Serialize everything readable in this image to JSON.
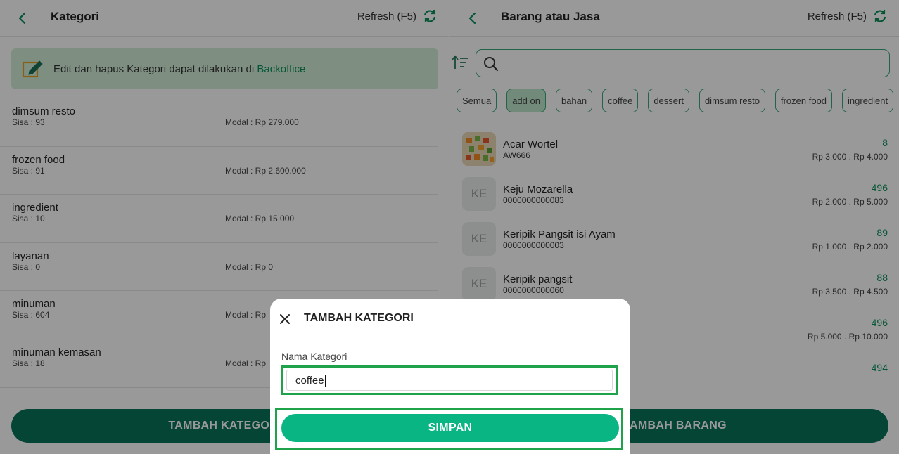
{
  "left_panel": {
    "title": "Kategori",
    "refresh_label": "Refresh (F5)",
    "notice": {
      "text": "Edit dan hapus Kategori dapat dilakukan di",
      "link": "Backoffice"
    },
    "categories": [
      {
        "name": "dimsum resto",
        "sisa": "Sisa : 93",
        "modal": "Modal : Rp 279.000"
      },
      {
        "name": "frozen food",
        "sisa": "Sisa : 91",
        "modal": "Modal : Rp 2.600.000"
      },
      {
        "name": "ingredient",
        "sisa": "Sisa : 10",
        "modal": "Modal : Rp 15.000"
      },
      {
        "name": "layanan",
        "sisa": "Sisa : 0",
        "modal": "Modal : Rp 0"
      },
      {
        "name": "minuman",
        "sisa": "Sisa : 604",
        "modal": "Modal : Rp"
      },
      {
        "name": "minuman kemasan",
        "sisa": "Sisa : 18",
        "modal": "Modal : Rp"
      }
    ],
    "add_button": "TAMBAH KATEGORI"
  },
  "right_panel": {
    "title": "Barang atau Jasa",
    "refresh_label": "Refresh (F5)",
    "search_placeholder": "",
    "chips": [
      "Semua",
      "add on",
      "bahan",
      "coffee",
      "dessert",
      "dimsum resto",
      "frozen food",
      "ingredient"
    ],
    "active_chip": "add on",
    "items": [
      {
        "name": "Acar Wortel",
        "code": "AW666",
        "stock": "8",
        "price": "Rp 3.000 .  Rp 4.000",
        "thumb": "image"
      },
      {
        "name": "Keju Mozarella",
        "code": "0000000000083",
        "stock": "496",
        "price": "Rp 2.000 .  Rp 5.000",
        "thumb": "KE"
      },
      {
        "name": "Keripik Pangsit isi Ayam",
        "code": "0000000000003",
        "stock": "89",
        "price": "Rp 1.000 .  Rp 2.000",
        "thumb": "KE"
      },
      {
        "name": "Keripik pangsit",
        "code": "0000000000060",
        "stock": "88",
        "price": "Rp 3.500 .  Rp 4.500",
        "thumb": "KE"
      },
      {
        "name": "",
        "code": "",
        "stock": "496",
        "price": "Rp 5.000 .  Rp 10.000",
        "thumb": ""
      },
      {
        "name": "",
        "code": "",
        "stock": "494",
        "price": "",
        "thumb": ""
      }
    ],
    "add_button": "TAMBAH BARANG"
  },
  "dialog": {
    "title": "TAMBAH KATEGORI",
    "field_label": "Nama Kategori",
    "field_value": "coffee",
    "save_button": "SIMPAN"
  },
  "colors": {
    "accent": "#08735a",
    "link": "#0a8f5a",
    "chip_border": "#3aa57a",
    "chip_active": "#bfe6cc",
    "save_button": "#08b583",
    "highlight": "#1ea34a"
  }
}
